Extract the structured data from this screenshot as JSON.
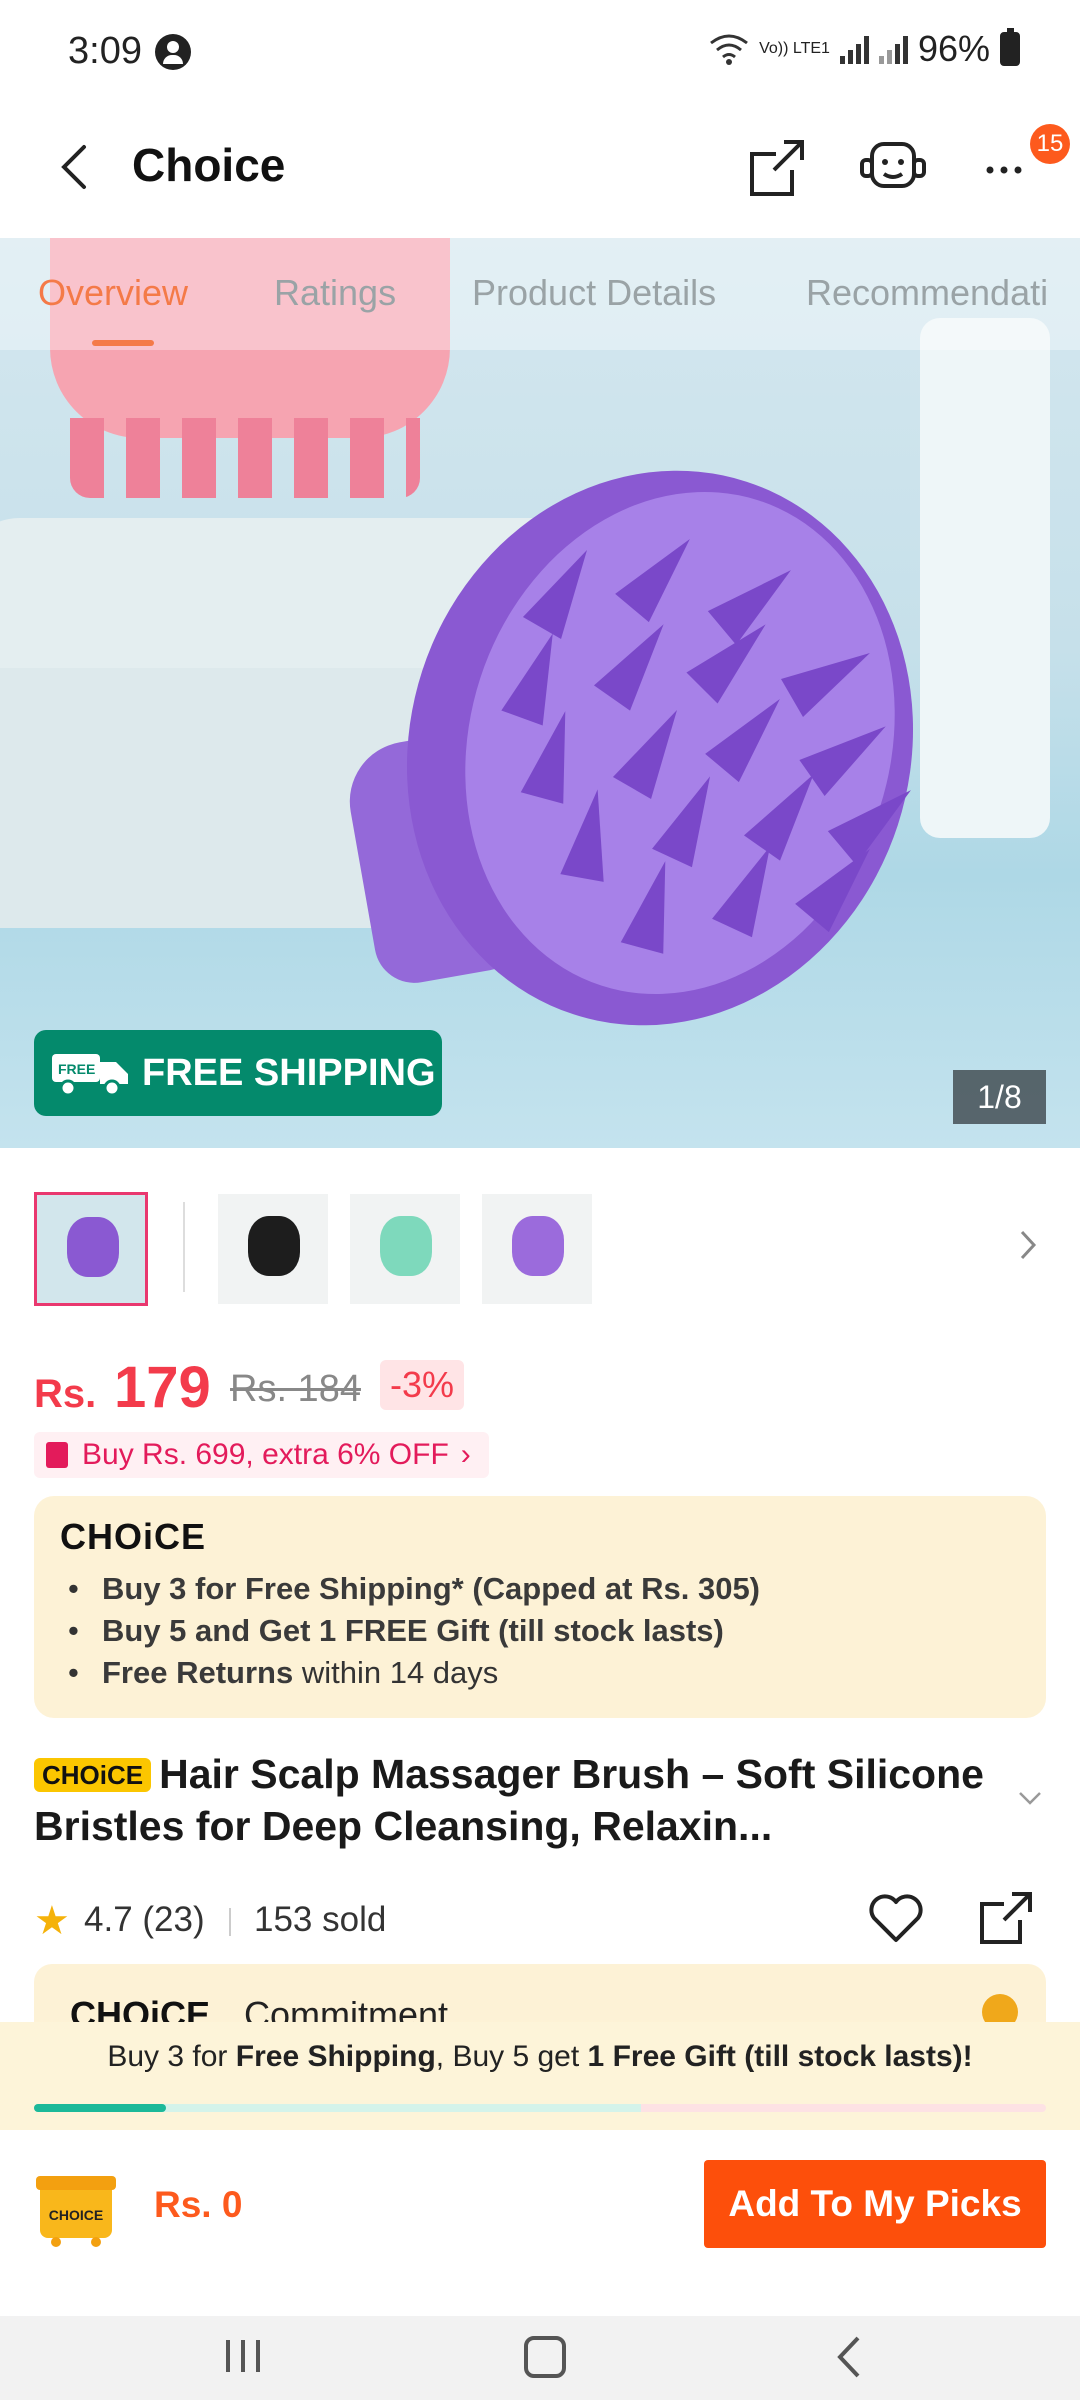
{
  "status": {
    "time": "3:09",
    "battery": "96%",
    "volte": "Vo)) LTE1"
  },
  "header": {
    "title": "Choice",
    "notification_count": "15"
  },
  "tabs": [
    {
      "label": "Overview",
      "active": true
    },
    {
      "label": "Ratings",
      "active": false
    },
    {
      "label": "Product Details",
      "active": false
    },
    {
      "label": "Recommendati",
      "active": false
    }
  ],
  "gallery": {
    "badge_text": "FREE SHIPPING",
    "badge_small": "FREE",
    "counter": "1/8"
  },
  "thumbnails": [
    {
      "name": "light-blue",
      "color": "#8a59d2",
      "selected": true
    },
    {
      "name": "black",
      "color": "#1d1d1d",
      "selected": false
    },
    {
      "name": "mint",
      "color": "#7ed9bc",
      "selected": false
    },
    {
      "name": "purple",
      "color": "#9b6bdc",
      "selected": false
    }
  ],
  "price": {
    "currency": "Rs.",
    "amount": "179",
    "original": "Rs. 184",
    "discount": "-3%"
  },
  "promo": {
    "text": "Buy Rs. 699, extra 6% OFF"
  },
  "choice": {
    "logo": "CHOiCE",
    "benefits": [
      {
        "bold": "Buy 3 for  Free Shipping* (Capped at Rs. 305)",
        "rest": ""
      },
      {
        "bold": "Buy 5 and Get 1 FREE Gift (till stock lasts)",
        "rest": ""
      },
      {
        "bold": "Free Returns",
        "rest": " within 14 days"
      }
    ]
  },
  "product": {
    "badge": "CHOiCE",
    "title": "Hair Scalp Massager Brush – Soft Silicone Bristles for Deep Cleansing, Relaxin...",
    "rating": "4.7 (23)",
    "sold": "153 sold"
  },
  "commitment": {
    "logo": "CHOiCE",
    "label": "Commitment"
  },
  "shipping_bar": {
    "part1": "Buy 3 for ",
    "bold1": "Free Shipping",
    "part2": ", Buy 5 get ",
    "bold2": "1 Free Gift (till stock lasts)!",
    "progress": 0.13
  },
  "bottom": {
    "cart_label": "CHOICE",
    "total": "Rs. 0",
    "button": "Add To My Picks"
  },
  "colors": {
    "accent": "#fd4f0b",
    "price": "#f33b4b",
    "choice_yellow": "#fbc600",
    "progress": "#1cb999"
  }
}
